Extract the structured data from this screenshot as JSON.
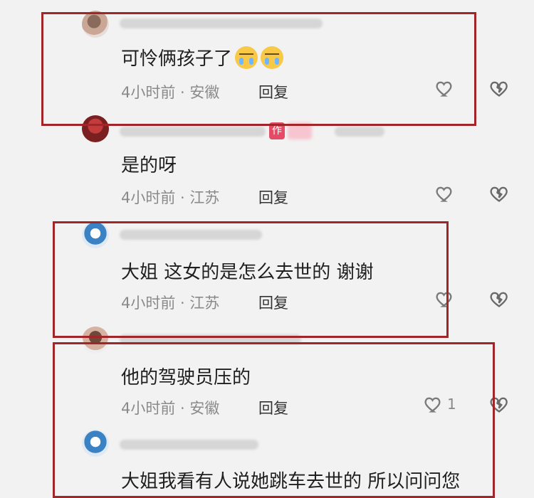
{
  "comments": [
    {
      "text": "可怜俩孩子了",
      "emojis": [
        "crying-face",
        "crying-face"
      ],
      "meta": "4小时前 · 安徽",
      "reply": "回复",
      "likes": ""
    },
    {
      "text": "是的呀",
      "tag": "作",
      "meta": "4小时前 · 江苏",
      "reply": "回复",
      "likes": ""
    },
    {
      "text": "大姐 这女的是怎么去世的  谢谢",
      "meta": "4小时前 · 江苏",
      "reply": "回复",
      "likes": ""
    },
    {
      "text": "他的驾驶员压的",
      "meta": "4小时前 · 安徽",
      "reply": "回复",
      "likes": "1"
    },
    {
      "text": "大姐我看有人说她跳车去世的  所以问问您"
    }
  ],
  "colors": {
    "highlight_box": "#a0262a",
    "tag_bg": "#e54b66",
    "meta_text": "#8a8a8a"
  }
}
